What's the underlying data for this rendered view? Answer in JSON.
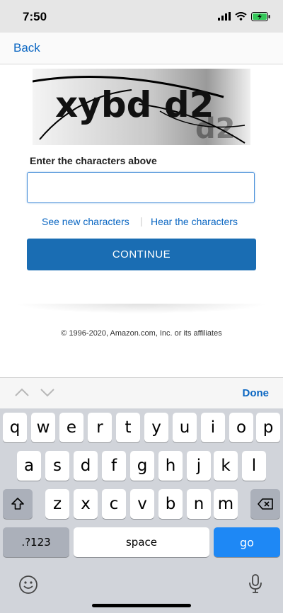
{
  "status_bar": {
    "time": "7:50"
  },
  "nav": {
    "back_label": "Back"
  },
  "form": {
    "captcha_text": "xybd d2",
    "field_label": "Enter the characters above",
    "input_value": "",
    "new_characters_link": "See new characters",
    "separator": "|",
    "hear_characters_link": "Hear the characters",
    "continue_label": "CONTINUE"
  },
  "footer": {
    "copyright": "© 1996-2020, Amazon.com, Inc. or its affiliates"
  },
  "keyboard_toolbar": {
    "done_label": "Done"
  },
  "keyboard": {
    "row1": [
      "q",
      "w",
      "e",
      "r",
      "t",
      "y",
      "u",
      "i",
      "o",
      "p"
    ],
    "row2": [
      "a",
      "s",
      "d",
      "f",
      "g",
      "h",
      "j",
      "k",
      "l"
    ],
    "row3": [
      "z",
      "x",
      "c",
      "v",
      "b",
      "n",
      "m"
    ],
    "numbers_label": ".?123",
    "space_label": "space",
    "go_label": "go",
    "icons": [
      "shift-icon",
      "backspace-icon",
      "emoji-icon",
      "microphone-icon"
    ]
  },
  "colors": {
    "accent": "#0a66c2",
    "button": "#1a6db3",
    "go_key": "#1e88f5"
  }
}
